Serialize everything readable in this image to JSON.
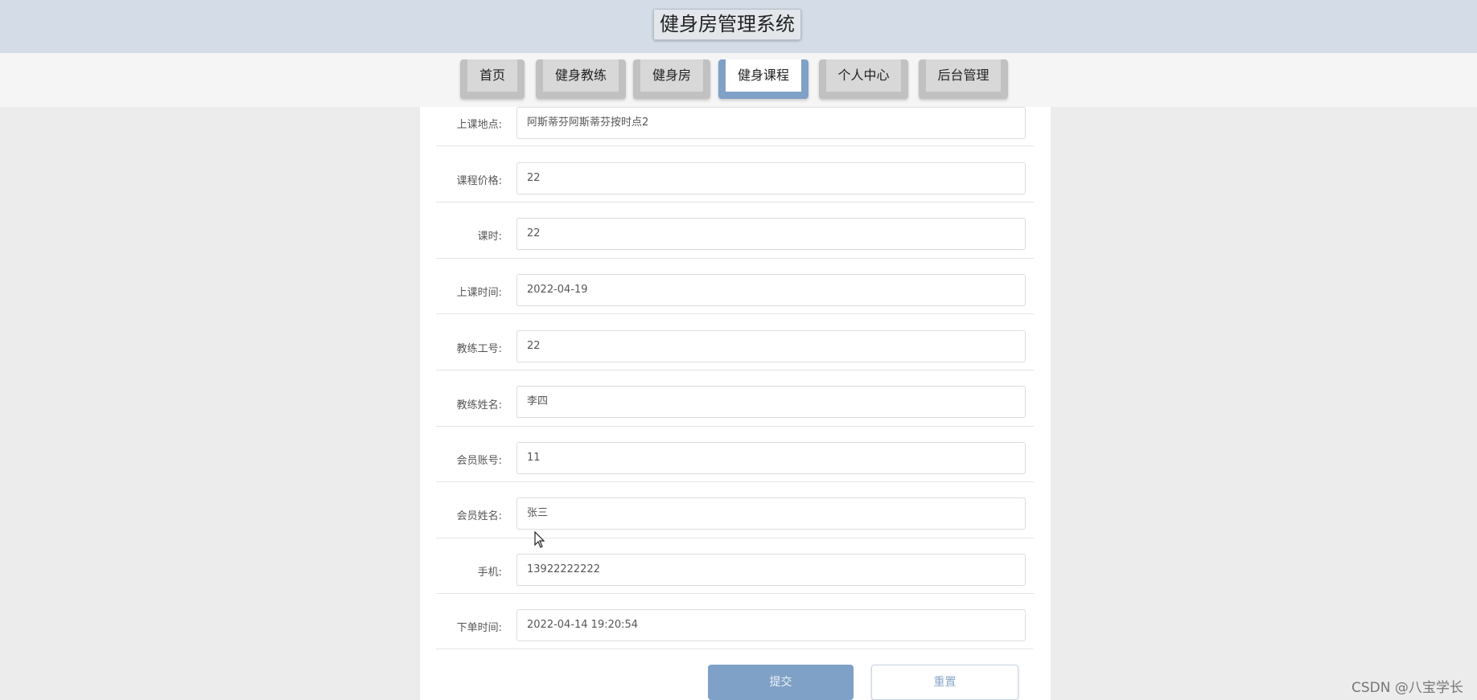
{
  "app": {
    "title": "健身房管理系统"
  },
  "nav": {
    "items": [
      {
        "label": "首页",
        "active": false
      },
      {
        "label": "健身教练",
        "active": false
      },
      {
        "label": "健身房",
        "active": false
      },
      {
        "label": "健身课程",
        "active": true
      },
      {
        "label": "个人中心",
        "active": false
      },
      {
        "label": "后台管理",
        "active": false
      }
    ]
  },
  "form": {
    "fields": [
      {
        "label": "上课地点:",
        "value": "阿斯蒂芬阿斯蒂芬按时点2"
      },
      {
        "label": "课程价格:",
        "value": "22"
      },
      {
        "label": "课时:",
        "value": "22"
      },
      {
        "label": "上课时间:",
        "value": "2022-04-19"
      },
      {
        "label": "教练工号:",
        "value": "22"
      },
      {
        "label": "教练姓名:",
        "value": "李四"
      },
      {
        "label": "会员账号:",
        "value": "11"
      },
      {
        "label": "会员姓名:",
        "value": "张三"
      },
      {
        "label": "手机:",
        "value": "13922222222"
      },
      {
        "label": "下单时间:",
        "value": "2022-04-14 19:20:54"
      }
    ],
    "submit_label": "提交",
    "reset_label": "重置"
  },
  "watermark": "CSDN @八宝学长",
  "colors": {
    "accent": "#7fa0c7",
    "header_bg": "#d4dde7",
    "page_bg": "#ececec"
  }
}
